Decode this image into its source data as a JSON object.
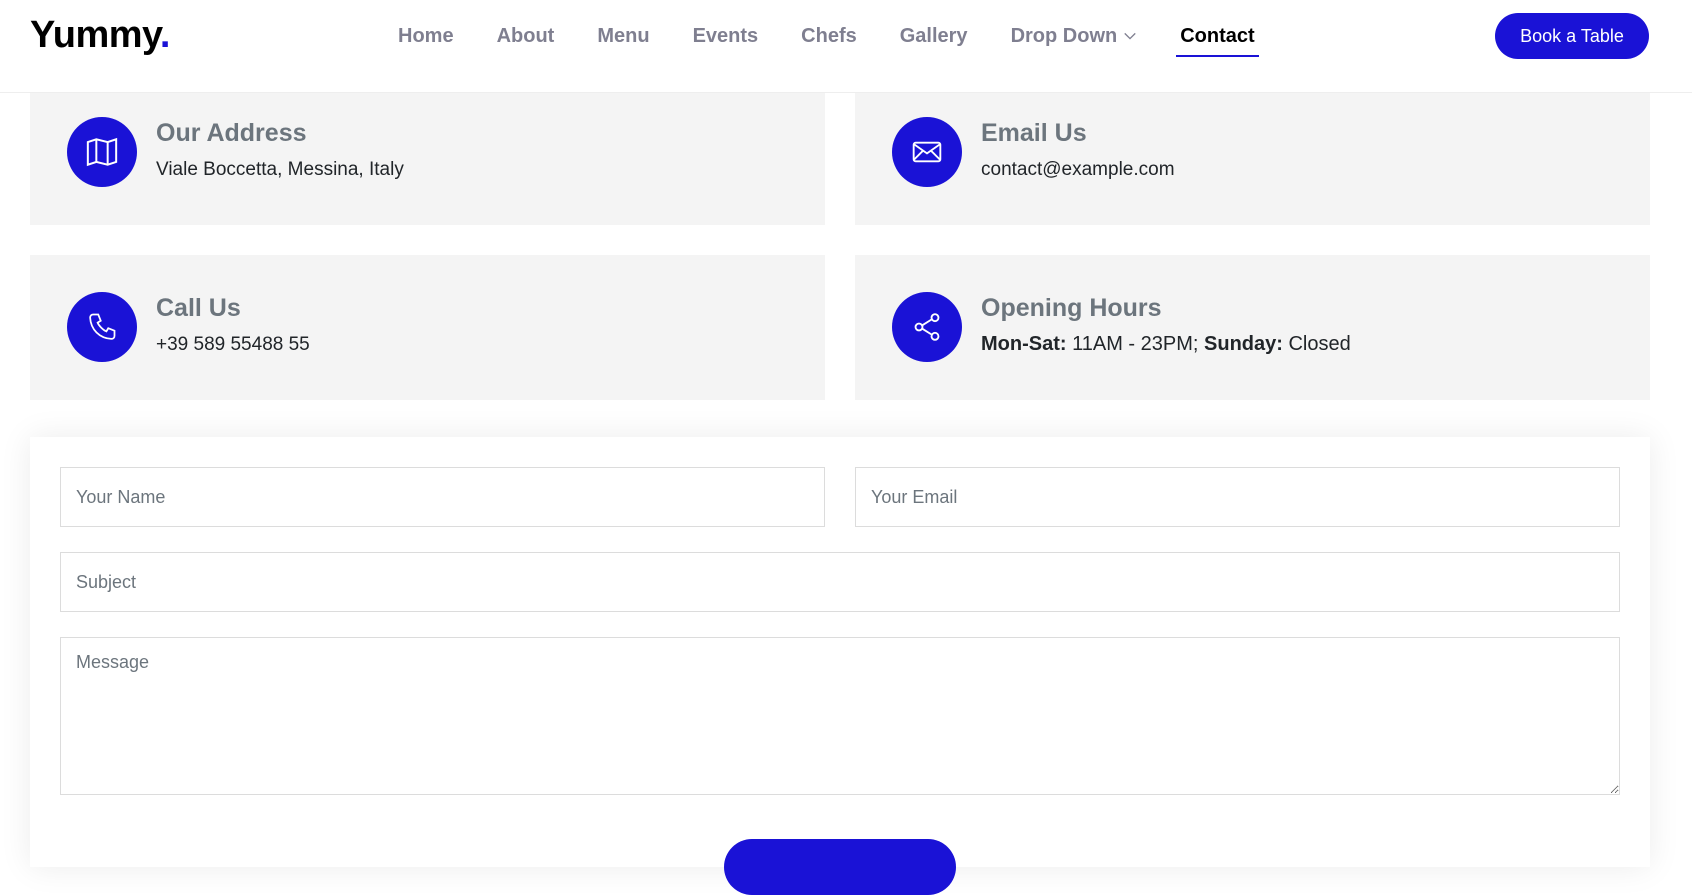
{
  "theme": {
    "accent": "#1a12d6"
  },
  "header": {
    "logo_text": "Yummy",
    "logo_dot": ".",
    "nav": [
      {
        "label": "Home"
      },
      {
        "label": "About"
      },
      {
        "label": "Menu"
      },
      {
        "label": "Events"
      },
      {
        "label": "Chefs"
      },
      {
        "label": "Gallery"
      },
      {
        "label": "Drop Down",
        "has_dropdown": true
      },
      {
        "label": "Contact",
        "active": true
      }
    ],
    "cta_label": "Book a Table"
  },
  "info": {
    "address": {
      "icon": "map-icon",
      "title": "Our Address",
      "text": "Viale Boccetta, Messina, Italy"
    },
    "email": {
      "icon": "envelope-icon",
      "title": "Email Us",
      "text": "contact@example.com"
    },
    "phone": {
      "icon": "phone-icon",
      "title": "Call Us",
      "text": "+39 589 55488 55"
    },
    "hours": {
      "icon": "share-icon",
      "title": "Opening Hours",
      "weekday_label": "Mon-Sat:",
      "weekday_value": "11AM - 23PM;",
      "sunday_label": "Sunday:",
      "sunday_value": "Closed"
    }
  },
  "form": {
    "name_placeholder": "Your Name",
    "email_placeholder": "Your Email",
    "subject_placeholder": "Subject",
    "message_placeholder": "Message"
  }
}
